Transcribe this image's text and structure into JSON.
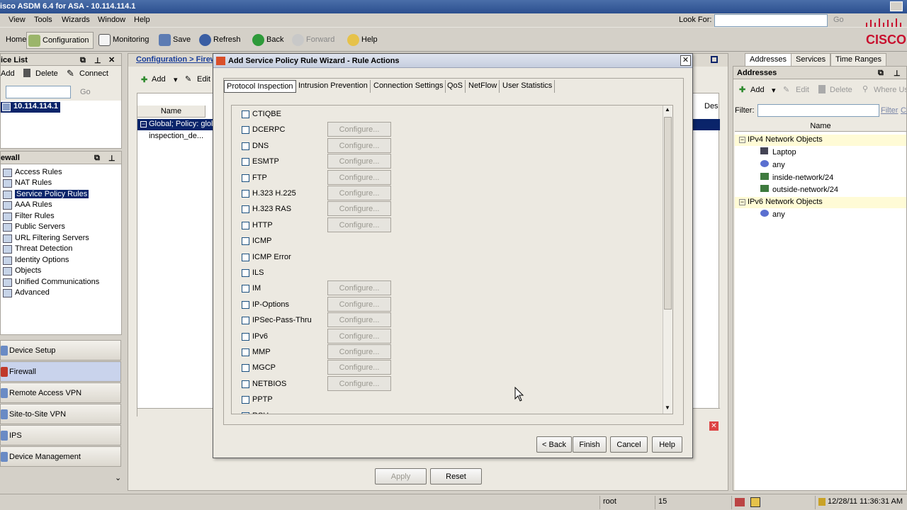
{
  "window": {
    "title": "isco ASDM 6.4 for ASA - 10.114.114.1"
  },
  "menu": [
    "View",
    "Tools",
    "Wizards",
    "Window",
    "Help"
  ],
  "lookfor": {
    "label": "Look For:",
    "go": "Go"
  },
  "toolbar": {
    "home": "Home",
    "configuration": "Configuration",
    "monitoring": "Monitoring",
    "save": "Save",
    "refresh": "Refresh",
    "back": "Back",
    "forward": "Forward",
    "help": "Help"
  },
  "device_list": {
    "title": "ice List",
    "add": "Add",
    "delete": "Delete",
    "connect": "Connect",
    "go": "Go",
    "device": "10.114.114.1"
  },
  "firewall": {
    "title": "ewall",
    "items": [
      "Access Rules",
      "NAT Rules",
      "Service Policy Rules",
      "AAA Rules",
      "Filter Rules",
      "Public Servers",
      "URL Filtering Servers",
      "Threat Detection",
      "Identity Options",
      "Objects",
      "Unified Communications",
      "Advanced"
    ]
  },
  "nav": [
    "Device Setup",
    "Firewall",
    "Remote Access VPN",
    "Site-to-Site VPN",
    "IPS",
    "Device Management"
  ],
  "center": {
    "breadcrumb": "Configuration > Firewall",
    "add": "Add",
    "edit": "Edit",
    "col_name": "Name",
    "col_desc": "Des",
    "row1": "Global; Policy: glob",
    "row2": "inspection_de...",
    "apply": "Apply",
    "reset": "Reset"
  },
  "dialog": {
    "title": "Add Service Policy Rule Wizard - Rule Actions",
    "tabs": [
      "Protocol Inspection",
      "Intrusion Prevention",
      "Connection Settings",
      "QoS",
      "NetFlow",
      "User Statistics"
    ],
    "configure_label": "Configure...",
    "protocols": [
      {
        "name": "CTIQBE",
        "configure": false
      },
      {
        "name": "DCERPC",
        "configure": true
      },
      {
        "name": "DNS",
        "configure": true
      },
      {
        "name": "ESMTP",
        "configure": true
      },
      {
        "name": "FTP",
        "configure": true
      },
      {
        "name": "H.323 H.225",
        "configure": true
      },
      {
        "name": "H.323 RAS",
        "configure": true
      },
      {
        "name": "HTTP",
        "configure": true
      },
      {
        "name": "ICMP",
        "configure": false
      },
      {
        "name": "ICMP Error",
        "configure": false
      },
      {
        "name": "ILS",
        "configure": false
      },
      {
        "name": "IM",
        "configure": true
      },
      {
        "name": "IP-Options",
        "configure": true
      },
      {
        "name": "IPSec-Pass-Thru",
        "configure": true
      },
      {
        "name": "IPv6",
        "configure": true
      },
      {
        "name": "MMP",
        "configure": true
      },
      {
        "name": "MGCP",
        "configure": true
      },
      {
        "name": "NETBIOS",
        "configure": true
      },
      {
        "name": "PPTP",
        "configure": false
      },
      {
        "name": "RSH",
        "configure": false
      }
    ],
    "back": "< Back",
    "finish": "Finish",
    "cancel": "Cancel",
    "help": "Help"
  },
  "right": {
    "tabs": [
      "Addresses",
      "Services",
      "Time Ranges"
    ],
    "title": "Addresses",
    "add": "Add",
    "edit": "Edit",
    "delete": "Delete",
    "whereused": "Where Us",
    "filter": "Filter:",
    "filter_btn": "Filter",
    "clear_btn": "Cl",
    "col_name": "Name",
    "ipv4_group": "IPv4 Network Objects",
    "ipv4_items": [
      "Laptop",
      "any",
      "inside-network/24",
      "outside-network/24"
    ],
    "ipv6_group": "IPv6 Network Objects",
    "ipv6_items": [
      "any"
    ]
  },
  "status": {
    "user": "root",
    "count": "15",
    "datetime": "12/28/11 11:36:31 AM"
  }
}
